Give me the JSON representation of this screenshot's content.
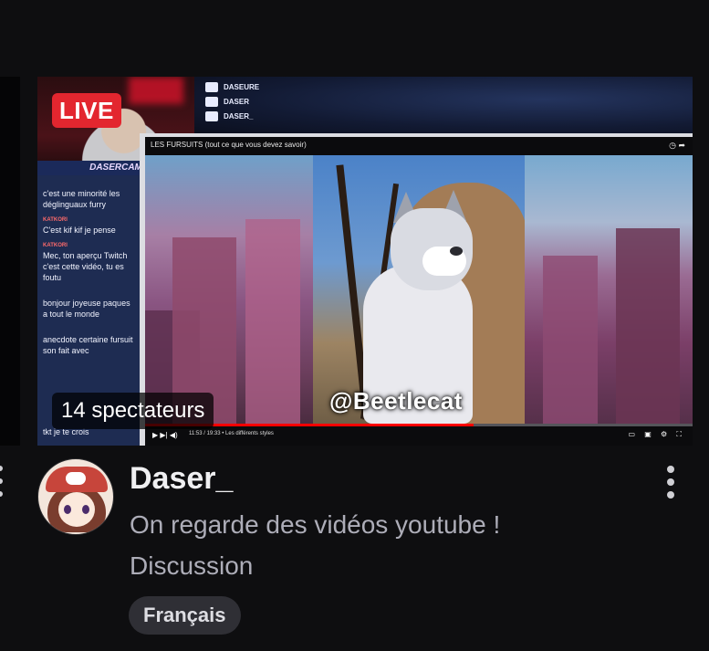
{
  "stream": {
    "live_label": "LIVE",
    "viewers_label": "14 spectateurs",
    "channel_name": "Daser_",
    "title": "On regarde des vidéos youtube !",
    "category": "Discussion",
    "tag": "Français"
  },
  "thumbnail": {
    "cam_banner": "DASERCAM",
    "socials": [
      "DASEURE",
      "DASER",
      "DASER_"
    ],
    "chat": [
      {
        "user": "",
        "text": "c'est une minorité les déglinguaux furry"
      },
      {
        "user": "KATKORI",
        "text": "C'est kif kif je pense"
      },
      {
        "user": "KATKORI",
        "text": "Mec, ton aperçu Twitch c'est cette vidéo, tu es foutu"
      },
      {
        "user": "",
        "text": "bonjour joyeuse paques a tout le monde"
      },
      {
        "user": "",
        "text": "anecdote certaine fursuit son fait avec"
      }
    ],
    "chat_last": "tkt je te crois",
    "yt_title": "LES FURSUITS (tout ce que vous devez savoir)",
    "yt_time": "11:53 / 19:33 • Les différents styles",
    "yt_progress": 0.6,
    "watermark": "@Beetlecat"
  },
  "colors": {
    "live": "#e3262f",
    "background": "#0e0e10",
    "text_primary": "#efeff1",
    "text_secondary": "#adadb8",
    "tag_bg": "#2f2f35"
  },
  "icons": [
    "twitter-icon",
    "youtube-icon",
    "twitch-icon",
    "more-vertical-icon",
    "play-icon",
    "share-icon"
  ]
}
